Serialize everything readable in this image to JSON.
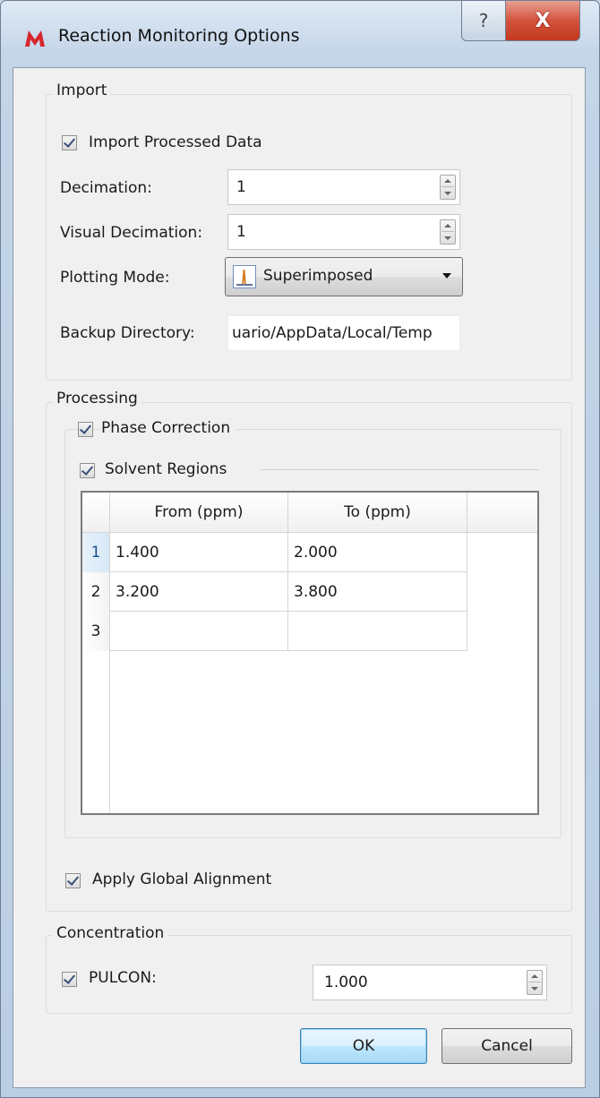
{
  "window": {
    "title": "Reaction Monitoring Options",
    "help_glyph": "?",
    "close_glyph": "X"
  },
  "import_group": {
    "title": "Import",
    "import_processed_label": "Import Processed Data",
    "import_processed_checked": true,
    "decimation_label": "Decimation:",
    "decimation_value": "1",
    "visual_decimation_label": "Visual Decimation:",
    "visual_decimation_value": "1",
    "plotting_mode_label": "Plotting Mode:",
    "plotting_mode_value": "Superimposed",
    "plotting_mode_icon": "peak-chart-icon",
    "backup_directory_label": "Backup Directory:",
    "backup_directory_value": "uario/AppData/Local/Temp"
  },
  "processing_group": {
    "title": "Processing",
    "phase_correction_label": "Phase Correction",
    "phase_correction_checked": true,
    "solvent_regions_label": "Solvent Regions",
    "solvent_regions_checked": true,
    "table": {
      "columns": [
        "From (ppm)",
        "To (ppm)"
      ],
      "rows": [
        {
          "index": "1",
          "from": "1.400",
          "to": "2.000"
        },
        {
          "index": "2",
          "from": "3.200",
          "to": "3.800"
        },
        {
          "index": "3",
          "from": "",
          "to": ""
        }
      ]
    },
    "apply_global_alignment_label": "Apply Global Alignment",
    "apply_global_alignment_checked": true
  },
  "concentration_group": {
    "title": "Concentration",
    "pulcon_label": "PULCON:",
    "pulcon_checked": true,
    "pulcon_value": "1.000"
  },
  "buttons": {
    "ok": "OK",
    "cancel": "Cancel"
  }
}
